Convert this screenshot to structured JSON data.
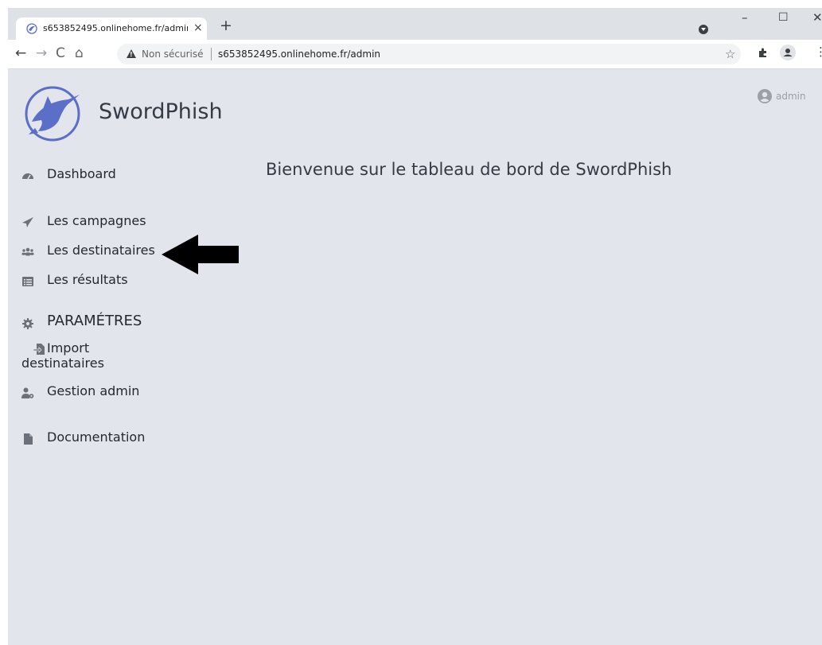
{
  "browser": {
    "tab_title": "s653852495.onlinehome.fr/admin",
    "tab_close": "×",
    "new_tab": "+",
    "window_minimize": "–",
    "window_maximize": "☐",
    "window_close": "✕",
    "nav_back": "←",
    "nav_forward": "→",
    "nav_reload": "C",
    "nav_home": "⌂",
    "security_label": "Non sécurisé",
    "url": "s653852495.onlinehome.fr/admin",
    "bookmark_star": "☆",
    "menu": "⋮"
  },
  "header": {
    "brand": "SwordPhish",
    "user": "admin"
  },
  "main": {
    "welcome": "Bienvenue sur le tableau de bord de SwordPhish"
  },
  "sidebar": {
    "items": [
      {
        "label": "Dashboard",
        "icon": "tachometer-icon"
      },
      {
        "label": "Les campagnes",
        "icon": "paper-plane-icon"
      },
      {
        "label": "Les destinataires",
        "icon": "users-icon"
      },
      {
        "label": "Les résultats",
        "icon": "list-alt-icon"
      },
      {
        "label": "PARAMÉTRES",
        "icon": "gear-icon"
      },
      {
        "label_line1": "Import",
        "label_line2": "destinataires",
        "icon": "file-import-icon"
      },
      {
        "label": "Gestion admin",
        "icon": "user-gear-icon"
      },
      {
        "label": "Documentation",
        "icon": "file-icon"
      }
    ]
  },
  "annotation": {
    "icon": "black-arrow-icon"
  },
  "colors": {
    "page_background": "#e2e5ec",
    "text": "#24292f",
    "brand_blue": "#5b6fc9",
    "muted": "#9a9fa8"
  }
}
